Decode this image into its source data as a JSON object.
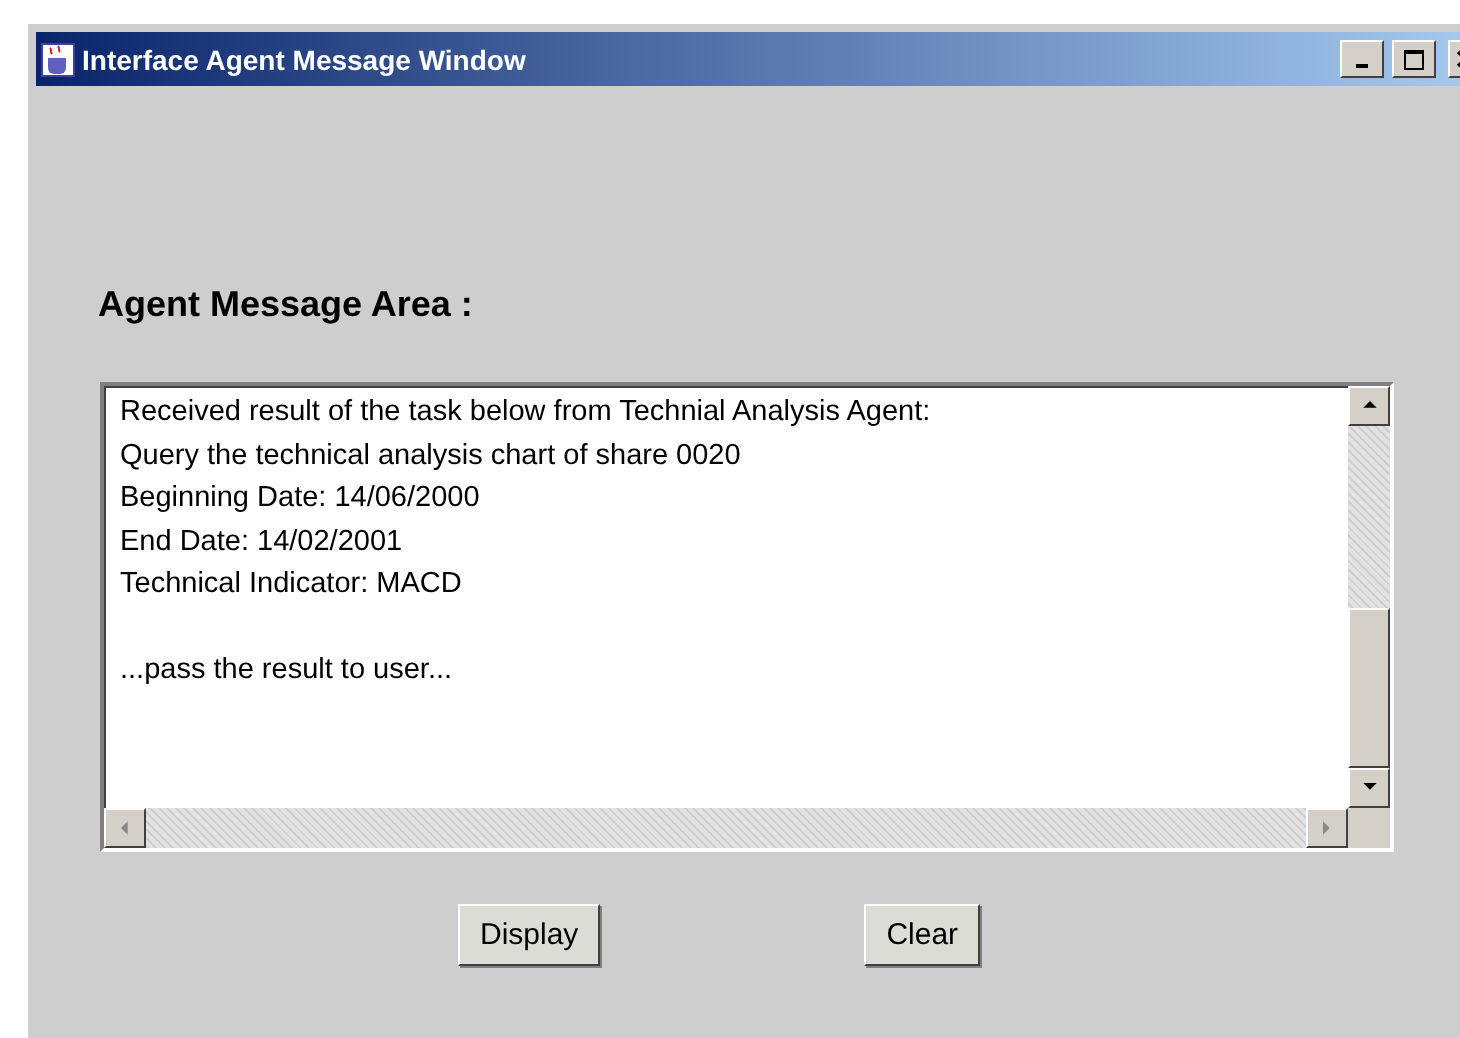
{
  "window": {
    "title": "Interface Agent Message Window"
  },
  "heading": "Agent Message Area :",
  "message_area": {
    "paragraphs": [
      [
        "Received result of the task below from Technial Analysis Agent:",
        "Query the technical analysis chart of share 0020",
        "Beginning Date: 14/06/2000",
        "End Date: 14/02/2001",
        "Technical Indicator: MACD"
      ],
      [
        "...pass the result to user..."
      ]
    ]
  },
  "buttons": [
    "Display",
    "Clear"
  ]
}
